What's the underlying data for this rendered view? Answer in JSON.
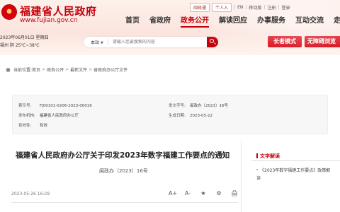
{
  "colors": {
    "brand": "#c4000b",
    "accent": "#d7000f"
  },
  "header": {
    "title": "福建省人民政府",
    "url": "www.fujian.gov.cn",
    "date": "2023年06月01日 星期四",
    "weather": "福州 阴 25℃~38℃",
    "emblem_icon": "emblem-icon"
  },
  "top_links": {
    "account": "闽政通",
    "personal": "个人入",
    "lang": "EN",
    "mobile": "移动版",
    "register": "注册",
    "login": "登录",
    "sep": "|"
  },
  "nav": {
    "items": [
      {
        "label": "首页"
      },
      {
        "label": "省政府"
      },
      {
        "label": "政务公开"
      },
      {
        "label": "解读回应"
      },
      {
        "label": "办事服务"
      },
      {
        "label": "互动交流"
      },
      {
        "label": "走进福建"
      }
    ],
    "active_index": 2
  },
  "search": {
    "scope": "本站",
    "caret": "▼",
    "placeholder": "请输入您要搜索的内容",
    "button_icon": "search-icon"
  },
  "buttons": {
    "elder_mode": "长者模式",
    "barrier_free": "无障碍浏览"
  },
  "breadcrumb": {
    "prefix": "当前位置:",
    "items": [
      "首页",
      "政务公开",
      "最新文件",
      "省政府办公厅文件"
    ],
    "sep": ">"
  },
  "meta": {
    "index_label": "索引号:",
    "index_value": "FJ00101-0206-2023-00016",
    "issuer_label": "发布机构:",
    "issuer_value": "福建省人民政府办公厅",
    "validity_label": "有效性:",
    "validity_value": "有效",
    "docno_label": "发文字号:",
    "docno_value": "闽政办〔2023〕16号",
    "date_label": "生成日期:",
    "date_value": "2023-05-22"
  },
  "document": {
    "title": "福建省人民政府办公厅关于印发2023年数字福建工作要点的通知",
    "number": "闽政办〔2023〕16号",
    "published": "2023-05-26 16:29",
    "tools": {
      "font_up": "A+",
      "font_down": "A-",
      "favorite": "★",
      "share": "⚙",
      "print": "🖨"
    }
  },
  "sidebar": {
    "heading": "文字解读",
    "link": "《2023年数字福建工作要点》政策解读"
  }
}
